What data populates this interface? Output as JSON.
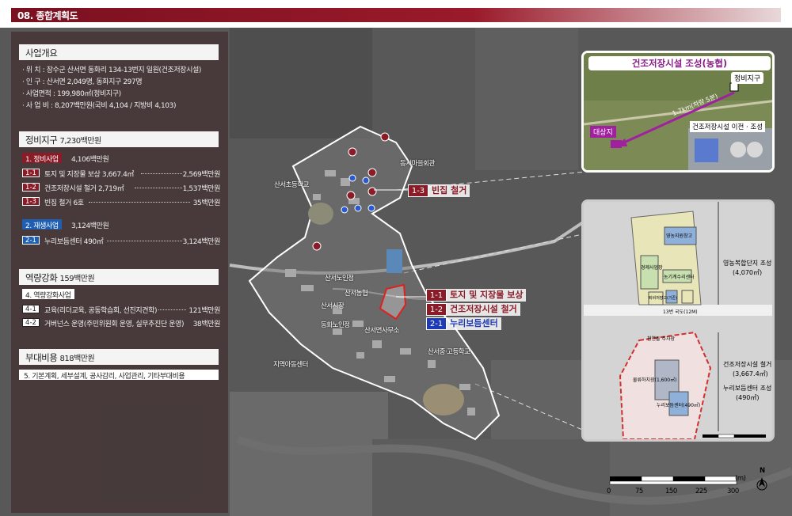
{
  "header": {
    "title": "08. 종합계획도"
  },
  "overview": {
    "title": "사업개요",
    "lines": [
      "· 위      치 : 장수군 산서면 동화리 134-13번지 일원(건조저장시설)",
      "· 인      구 : 산서면 2,049명, 동화지구 297명",
      "· 사업면적 : 199,980㎡(정비지구)",
      "· 사 업 비 : 8,207백만원(국비 4,104 / 지방비 4,103)"
    ]
  },
  "district": {
    "title": "정비지구",
    "title_amount": "7,230백만원",
    "group1": {
      "label": "1. 정비사업",
      "amount": "4,106백만원",
      "items": [
        {
          "num": "1-1",
          "text": "토지 및 지장물 보상 3,667.4㎡",
          "amount": "2,569백만원"
        },
        {
          "num": "1-2",
          "text": "건조저장시설 철거 2,719㎡",
          "amount": "1,537백만원"
        },
        {
          "num": "1-3",
          "text": "빈집 철거 6호",
          "amount": "35백만원"
        }
      ]
    },
    "group2": {
      "label": "2. 재생사업",
      "amount": "3,124백만원",
      "items": [
        {
          "num": "2-1",
          "text": "누리보듬센터 490㎡",
          "amount": "3,124백만원"
        }
      ]
    }
  },
  "capacity": {
    "title": "역량강화",
    "title_amount": "159백만원",
    "group_label": "4. 역량강화사업",
    "items": [
      {
        "num": "4-1",
        "text": "교육(리더교육, 공동학습회, 선진지견학)",
        "amount": "121백만원"
      },
      {
        "num": "4-2",
        "text": "거버넌스 운영(주민위원회 운영, 실무추진단 운영)",
        "amount": "38백만원"
      }
    ]
  },
  "incidental": {
    "title": "부대비용",
    "title_amount": "818백만원",
    "bar": "5. 기본계획, 세부설계, 공사감리, 사업관리, 기타부대비용"
  },
  "map_labels": {
    "l1": "동서마을회관",
    "l2": "산서초등학교",
    "l3": "산서노인정",
    "l4": "산서농협",
    "l5": "산서시장",
    "l6": "동화노인정",
    "l7": "산서면사무소",
    "l8": "산서중·고등학교",
    "l9": "지역아동센터"
  },
  "callouts": {
    "c13": {
      "num": "1-3",
      "text": "빈집 철거"
    },
    "c11": {
      "num": "1-1",
      "text": "토지 및 지장물 보상"
    },
    "c12": {
      "num": "1-2",
      "text": "건조저장시설 철거"
    },
    "c21": {
      "num": "2-1",
      "text": "누리보듬센터"
    }
  },
  "inset1": {
    "title": "건조저장시설 조성(농협)",
    "district_label": "정비지구",
    "site_label": "대상지",
    "distance": "1.7km(차량 5분)",
    "photo_caption": "건조저장시설 이전 · 조성"
  },
  "inset2": {
    "blocks": [
      "영농지원창고",
      "경제사업장",
      "농기계수리센터",
      "퇴비저장고(기존)",
      "농기계창고",
      "주유소",
      "천연돌 주차장",
      "놀이터",
      "물류하치장(1,600㎡)",
      "누리보듬센터(490㎡)"
    ],
    "road": "13번 국도(12M)",
    "note1_title": "영농복합단지 조성",
    "note1_value": "(4,070㎡)",
    "note2_title": "건조저장시설 철거",
    "note2_value": "(3,667.4㎡)",
    "note3_title": "누리보듬센터 조성",
    "note3_value": "(490㎡)",
    "scale_labels": [
      "0m",
      "15m",
      "25m",
      "50m"
    ]
  },
  "scalebar": {
    "unit": "(m)",
    "ticks": [
      "0",
      "75",
      "150",
      "225",
      "300"
    ],
    "north": "N"
  },
  "colors": {
    "accent_red": "#8a1c28",
    "accent_blue": "#1e5fb4",
    "magenta": "#8a1c88"
  }
}
